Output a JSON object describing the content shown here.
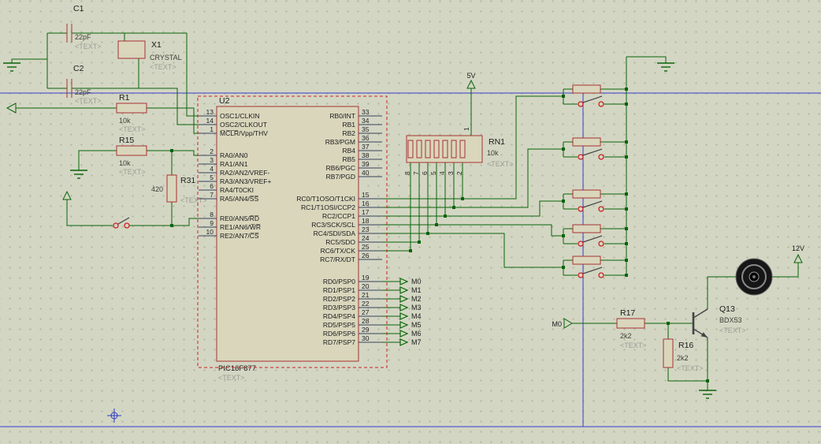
{
  "colors": {
    "background": "#d3d6c3",
    "grid_dot": "#b0b49e",
    "wire": "#0a640a",
    "component_outline": "#a83232",
    "component_fill": "#d9d6bc",
    "sheet_border": "#3a3acc",
    "selection": "#cc2222",
    "contact": "#cc2222",
    "text": "#1c1c1c",
    "muted_text": "#9c9c92"
  },
  "terminals": {
    "power_main": "5V",
    "power_motor": "12V",
    "motor_drive_input": "M0"
  },
  "outputs": [
    "M0",
    "M1",
    "M2",
    "M3",
    "M4",
    "M5",
    "M6",
    "M7"
  ],
  "components": {
    "c1": {
      "ref": "C1",
      "value": "22pF",
      "placeholder": "<TEXT>"
    },
    "c2": {
      "ref": "C2",
      "value": "22pF",
      "placeholder": "<TEXT>"
    },
    "x1": {
      "ref": "X1",
      "value": "CRYSTAL",
      "placeholder": "<TEXT>"
    },
    "r1": {
      "ref": "R1",
      "value": "10k",
      "placeholder": "<TEXT>"
    },
    "r15": {
      "ref": "R15",
      "value": "10k",
      "placeholder": "<TEXT>"
    },
    "r31": {
      "ref": "R31",
      "value": "420",
      "placeholder": "<TEXT>"
    },
    "rn1": {
      "ref": "RN1",
      "value": "10k",
      "placeholder": "<TEXT>",
      "top_pin": "1",
      "bottom_pins": [
        "8",
        "7",
        "6",
        "5",
        "4",
        "3",
        "2"
      ]
    },
    "r17": {
      "ref": "R17",
      "value": "2k2",
      "placeholder": "<TEXT>"
    },
    "r16": {
      "ref": "R16",
      "value": "2k2",
      "placeholder": "<TEXT>"
    },
    "q13": {
      "ref": "Q13",
      "value": "BDX53",
      "placeholder": "<TEXT>"
    },
    "u2": {
      "ref": "U2",
      "part": "PIC16F877",
      "placeholder": "<TEXT>",
      "left_groups": [
        [
          {
            "num": "13",
            "name": "OSC1/CLKIN"
          },
          {
            "num": "14",
            "name": "OSC2/CLKOUT"
          },
          {
            "num": "1",
            "name": "M̅C̅L̅R̅/Vpp/THV"
          }
        ],
        [
          {
            "num": "2",
            "name": "RA0/AN0"
          },
          {
            "num": "3",
            "name": "RA1/AN1"
          },
          {
            "num": "4",
            "name": "RA2/AN2/VREF-"
          },
          {
            "num": "5",
            "name": "RA3/AN3/VREF+"
          },
          {
            "num": "6",
            "name": "RA4/T0CKI"
          },
          {
            "num": "7",
            "name": "RA5/AN4/S̅S̅"
          }
        ],
        [
          {
            "num": "8",
            "name": "RE0/AN5/R̅D̅"
          },
          {
            "num": "9",
            "name": "RE1/AN6/W̅R̅"
          },
          {
            "num": "10",
            "name": "RE2/AN7/C̅S̅"
          }
        ]
      ],
      "right_groups": [
        [
          {
            "num": "33",
            "name": "RB0/INT"
          },
          {
            "num": "34",
            "name": "RB1"
          },
          {
            "num": "35",
            "name": "RB2"
          },
          {
            "num": "36",
            "name": "RB3/PGM"
          },
          {
            "num": "37",
            "name": "RB4"
          },
          {
            "num": "38",
            "name": "RB5"
          },
          {
            "num": "39",
            "name": "RB6/PGC"
          },
          {
            "num": "40",
            "name": "RB7/PGD"
          }
        ],
        [
          {
            "num": "15",
            "name": "RC0/T1OSO/T1CKI"
          },
          {
            "num": "16",
            "name": "RC1/T1OSI/CCP2"
          },
          {
            "num": "17",
            "name": "RC2/CCP1"
          },
          {
            "num": "18",
            "name": "RC3/SCK/SCL"
          },
          {
            "num": "23",
            "name": "RC4/SDI/SDA"
          },
          {
            "num": "24",
            "name": "RC5/SDO"
          },
          {
            "num": "25",
            "name": "RC6/TX/CK"
          },
          {
            "num": "26",
            "name": "RC7/RX/DT"
          }
        ],
        [
          {
            "num": "19",
            "name": "RD0/PSP0"
          },
          {
            "num": "20",
            "name": "RD1/PSP1"
          },
          {
            "num": "21",
            "name": "RD2/PSP2"
          },
          {
            "num": "22",
            "name": "RD3/PSP3"
          },
          {
            "num": "27",
            "name": "RD4/PSP4"
          },
          {
            "num": "28",
            "name": "RD5/PSP5"
          },
          {
            "num": "29",
            "name": "RD6/PSP6"
          },
          {
            "num": "30",
            "name": "RD7/PSP7"
          }
        ]
      ]
    }
  }
}
